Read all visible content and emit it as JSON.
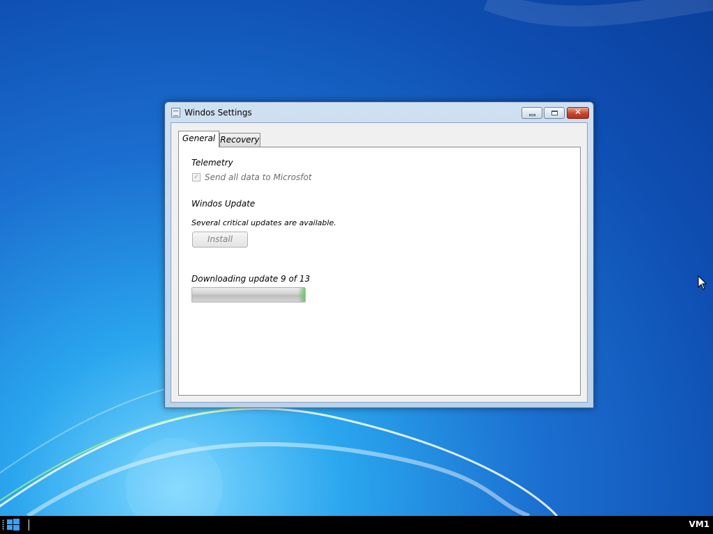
{
  "window": {
    "title": "Windos Settings",
    "close_glyph": "✕"
  },
  "tabs": [
    {
      "label": "General",
      "active": true
    },
    {
      "label": "Recovery",
      "active": false
    }
  ],
  "general": {
    "telemetry_heading": "Telemetry",
    "telemetry_checkbox_label": "Send all data to Microsfot",
    "telemetry_checked": true,
    "telemetry_enabled": false,
    "update_heading": "Windos Update",
    "update_status": "Several critical updates are available.",
    "install_button_label": "Install",
    "install_enabled": false,
    "download_status": "Downloading update 9 of 13",
    "progress_fraction": 1.0,
    "progress_color": "#5abe5a"
  },
  "taskbar": {
    "tray_label": "VM1",
    "start_icon": "windows-logo-icon"
  },
  "colors": {
    "desktop_blue": "#1b6fd0",
    "close_red": "#c8452f"
  }
}
